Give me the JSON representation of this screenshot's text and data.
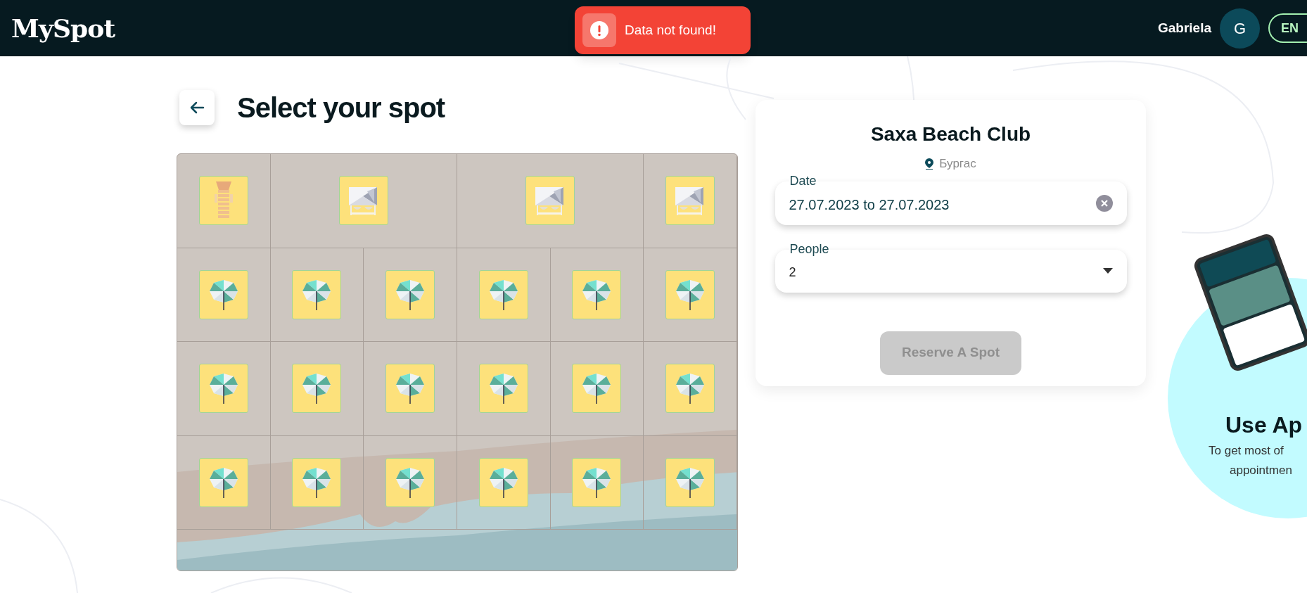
{
  "header": {
    "logo": "MySpot",
    "user_name": "Gabriela",
    "avatar_initial": "G",
    "language": "EN"
  },
  "toast": {
    "kind": "error",
    "message": "Data not found!"
  },
  "page": {
    "title": "Select your spot"
  },
  "spot_map": {
    "rows": [
      [
        {
          "kind": "lounger",
          "wide": false
        },
        {
          "kind": "cabana",
          "wide": true
        },
        {
          "kind": "cabana",
          "wide": true
        },
        {
          "kind": "cabana",
          "wide": false
        }
      ],
      [
        {
          "kind": "umbrella",
          "wide": false
        },
        {
          "kind": "umbrella",
          "wide": false
        },
        {
          "kind": "umbrella",
          "wide": false
        },
        {
          "kind": "umbrella",
          "wide": false
        },
        {
          "kind": "umbrella",
          "wide": false
        },
        {
          "kind": "umbrella",
          "wide": false
        }
      ],
      [
        {
          "kind": "umbrella",
          "wide": false
        },
        {
          "kind": "umbrella",
          "wide": false
        },
        {
          "kind": "umbrella",
          "wide": false
        },
        {
          "kind": "umbrella",
          "wide": false
        },
        {
          "kind": "umbrella",
          "wide": false
        },
        {
          "kind": "umbrella",
          "wide": false
        }
      ],
      [
        {
          "kind": "umbrella",
          "wide": false
        },
        {
          "kind": "umbrella",
          "wide": false
        },
        {
          "kind": "umbrella",
          "wide": false
        },
        {
          "kind": "umbrella",
          "wide": false
        },
        {
          "kind": "umbrella",
          "wide": false
        },
        {
          "kind": "umbrella",
          "wide": false
        }
      ]
    ]
  },
  "venue": {
    "name": "Saxa Beach Club",
    "location": "Бургас"
  },
  "date_field": {
    "label": "Date",
    "value": "27.07.2023 to 27.07.2023"
  },
  "people_field": {
    "label": "People",
    "value": "2"
  },
  "reserve_button": {
    "label": "Reserve A Spot",
    "disabled": true
  },
  "promo": {
    "title": "Use Ap",
    "subtitle_lines": [
      "To get most of",
      "appointmen"
    ]
  }
}
